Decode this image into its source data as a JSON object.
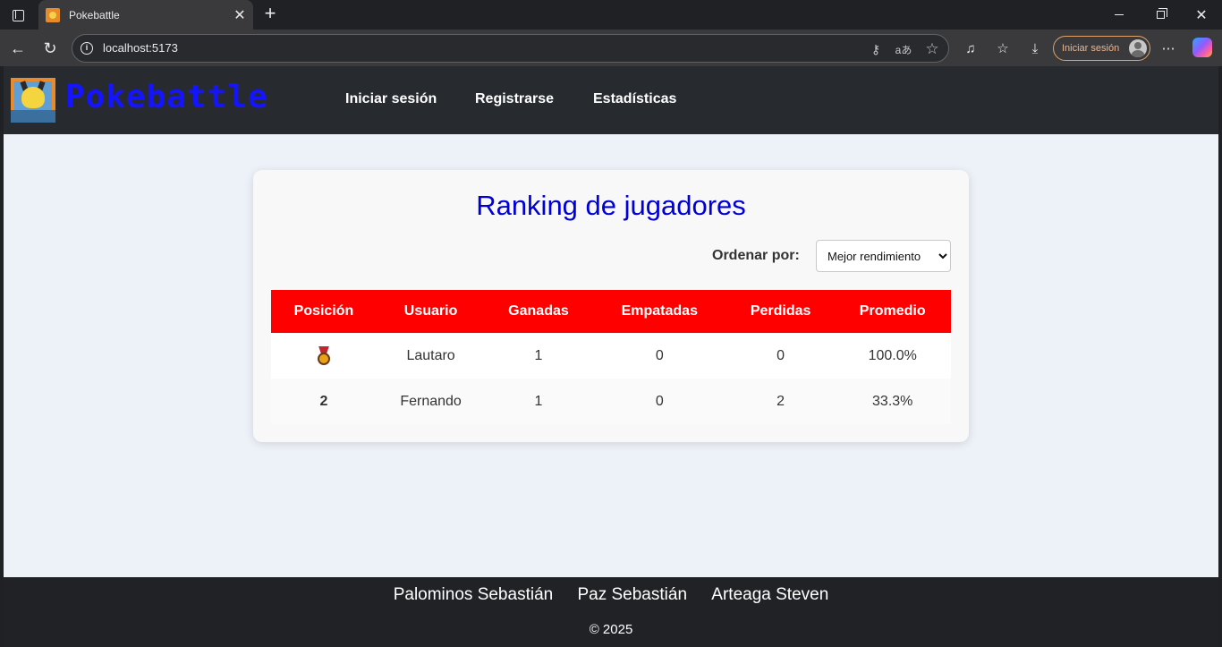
{
  "browser": {
    "tab_title": "Pokebattle",
    "url": "localhost:5173",
    "signin_label": "Iniciar sesión"
  },
  "site": {
    "brand": "Pokebattle",
    "nav": [
      "Iniciar sesión",
      "Registrarse",
      "Estadísticas"
    ]
  },
  "ranking": {
    "title": "Ranking de jugadores",
    "sort_label": "Ordenar por:",
    "sort_selected": "Mejor rendimiento",
    "columns": [
      "Posición",
      "Usuario",
      "Ganadas",
      "Empatadas",
      "Perdidas",
      "Promedio"
    ],
    "rows": [
      {
        "position": "",
        "medal_icon": "gold-medal-icon",
        "user": "Lautaro",
        "won": "1",
        "tied": "0",
        "lost": "0",
        "average": "100.0%"
      },
      {
        "position": "2",
        "user": "Fernando",
        "won": "1",
        "tied": "0",
        "lost": "2",
        "average": "33.3%"
      }
    ]
  },
  "footer": {
    "authors": [
      "Palominos Sebastián",
      "Paz Sebastián",
      "Arteaga Steven"
    ],
    "copyright": "© 2025"
  },
  "colors": {
    "accent_red": "#ff0000",
    "title_blue": "#0000d6",
    "brand_blue": "#1414ff",
    "header_dark": "#272b30"
  }
}
